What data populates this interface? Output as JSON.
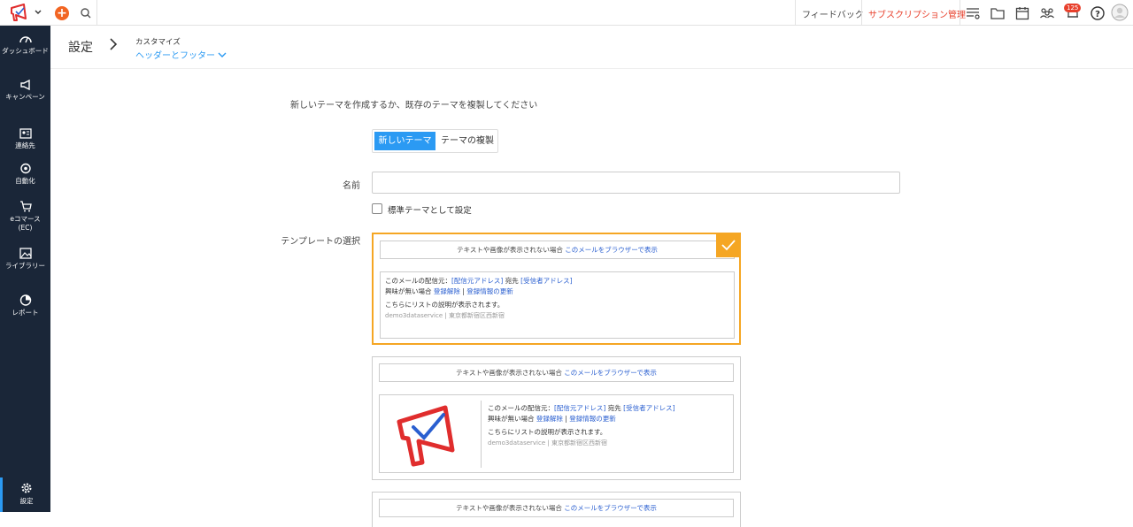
{
  "topbar": {
    "feedback": "フィードバック",
    "subscription": "サブスクリプション管理",
    "notification_count": "125"
  },
  "sidebar": {
    "items": [
      {
        "label": "ダッシュボード",
        "icon": "dashboard-icon"
      },
      {
        "label": "キャンペーン",
        "icon": "megaphone-icon"
      },
      {
        "label": "連絡先",
        "icon": "contact-card-icon"
      },
      {
        "label": "自動化",
        "icon": "automation-icon"
      },
      {
        "label": "eコマース(EC)",
        "icon": "cart-icon"
      },
      {
        "label": "ライブラリー",
        "icon": "image-library-icon"
      },
      {
        "label": "レポート",
        "icon": "pie-chart-icon"
      },
      {
        "label": "設定",
        "icon": "gear-icon"
      }
    ]
  },
  "header": {
    "title": "設定",
    "crumb_parent": "カスタマイズ",
    "crumb_current": "ヘッダーとフッター"
  },
  "form": {
    "intro": "新しいテーマを作成するか、既存のテーマを複製してください",
    "toggle_new": "新しいテーマ",
    "toggle_duplicate": "テーマの複製",
    "name_label": "名前",
    "name_value": "",
    "default_checkbox_label": "標準テーマとして設定",
    "template_label": "テンプレートの選択"
  },
  "template": {
    "bar_text": "テキストや画像が表示されない場合",
    "bar_link": "このメールをブラウザーで表示",
    "line1_prefix": "このメールの配信元：",
    "line1_from": "[配信元アドレス]",
    "line1_mid": "宛先",
    "line1_to": "[受信者アドレス]",
    "line2_prefix": "興味が無い場合",
    "line2_unsub": "登録解除",
    "line2_sep": "|",
    "line2_update": "登録情報の更新",
    "line3": "こちらにリストの説明が表示されます。",
    "line4": "demo3dataservice | 東京都新宿区西新宿"
  },
  "colors": {
    "accent": "#2b9af3",
    "selected_border": "#f5a623",
    "sidebar_bg": "#1a2638",
    "subscription_red": "#e8402c"
  }
}
